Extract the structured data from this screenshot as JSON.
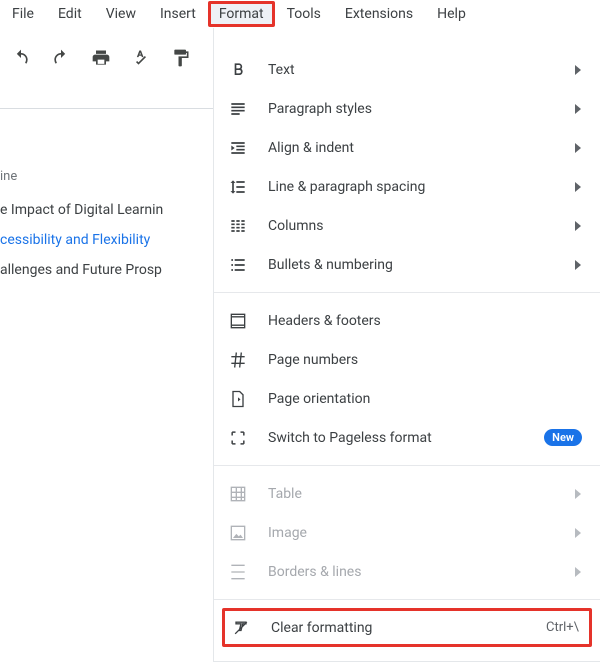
{
  "menubar": {
    "items": [
      "File",
      "Edit",
      "View",
      "Insert",
      "Format",
      "Tools",
      "Extensions",
      "Help"
    ],
    "highlighted_index": 4
  },
  "outline": {
    "label": "ine",
    "items": [
      {
        "text": "e Impact of Digital Learnin",
        "active": false
      },
      {
        "text": "cessibility and Flexibility",
        "active": true
      },
      {
        "text": "allenges and Future Prosp",
        "active": false
      }
    ]
  },
  "dropdown": {
    "groups": [
      [
        {
          "icon": "bold-icon",
          "label": "Text",
          "submenu": true
        },
        {
          "icon": "paragraph-styles-icon",
          "label": "Paragraph styles",
          "submenu": true
        },
        {
          "icon": "align-indent-icon",
          "label": "Align & indent",
          "submenu": true
        },
        {
          "icon": "line-spacing-icon",
          "label": "Line & paragraph spacing",
          "submenu": true
        },
        {
          "icon": "columns-icon",
          "label": "Columns",
          "submenu": true
        },
        {
          "icon": "bullets-numbering-icon",
          "label": "Bullets & numbering",
          "submenu": true
        }
      ],
      [
        {
          "icon": "headers-footers-icon",
          "label": "Headers & footers"
        },
        {
          "icon": "page-numbers-icon",
          "label": "Page numbers"
        },
        {
          "icon": "page-orientation-icon",
          "label": "Page orientation"
        },
        {
          "icon": "pageless-icon",
          "label": "Switch to Pageless format",
          "badge": "New"
        }
      ],
      [
        {
          "icon": "table-icon",
          "label": "Table",
          "submenu": true,
          "disabled": true
        },
        {
          "icon": "image-icon",
          "label": "Image",
          "submenu": true,
          "disabled": true
        },
        {
          "icon": "borders-lines-icon",
          "label": "Borders & lines",
          "submenu": true,
          "disabled": true
        }
      ],
      [
        {
          "icon": "clear-formatting-icon",
          "label": "Clear formatting",
          "shortcut": "Ctrl+\\",
          "highlighted": true
        }
      ]
    ]
  }
}
